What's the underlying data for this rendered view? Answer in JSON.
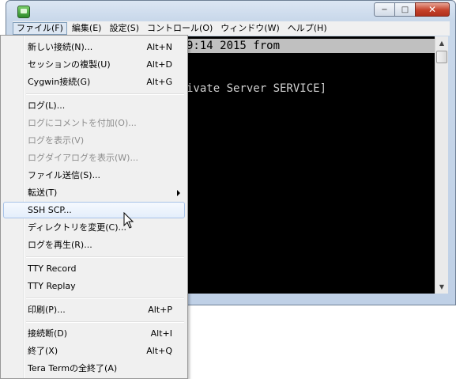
{
  "window": {
    "caption_buttons": {
      "minimize": "−",
      "maximize": "□",
      "close": "✕"
    }
  },
  "menubar": {
    "items": [
      "ファイル(F)",
      "編集(E)",
      "設定(S)",
      "コントロール(O)",
      "ウィンドウ(W)",
      "ヘルプ(H)"
    ],
    "active_index": 0
  },
  "terminal": {
    "lines": [
      "9:14 2015 from",
      "ivate Server SERVICE]"
    ],
    "bg_color": "#000000",
    "fg_color": "#d0d0d0"
  },
  "file_menu": {
    "items": [
      {
        "label": "新しい接続(N)...",
        "shortcut": "Alt+N",
        "enabled": true
      },
      {
        "label": "セッションの複製(U)",
        "shortcut": "Alt+D",
        "enabled": true
      },
      {
        "label": "Cygwin接続(G)",
        "shortcut": "Alt+G",
        "enabled": true
      },
      {
        "label": "ログ(L)...",
        "shortcut": "",
        "enabled": true
      },
      {
        "label": "ログにコメントを付加(O)...",
        "shortcut": "",
        "enabled": false
      },
      {
        "label": "ログを表示(V)",
        "shortcut": "",
        "enabled": false
      },
      {
        "label": "ログダイアログを表示(W)...",
        "shortcut": "",
        "enabled": false
      },
      {
        "label": "ファイル送信(S)...",
        "shortcut": "",
        "enabled": true
      },
      {
        "label": "転送(T)",
        "shortcut": "",
        "enabled": true,
        "submenu": true
      },
      {
        "label": "SSH SCP...",
        "shortcut": "",
        "enabled": true,
        "highlighted": true
      },
      {
        "label": "ディレクトリを変更(C)...",
        "shortcut": "",
        "enabled": true
      },
      {
        "label": "ログを再生(R)...",
        "shortcut": "",
        "enabled": true
      },
      {
        "label": "TTY Record",
        "shortcut": "",
        "enabled": true
      },
      {
        "label": "TTY Replay",
        "shortcut": "",
        "enabled": true
      },
      {
        "label": "印刷(P)...",
        "shortcut": "Alt+P",
        "enabled": true
      },
      {
        "label": "接続断(D)",
        "shortcut": "Alt+I",
        "enabled": true
      },
      {
        "label": "終了(X)",
        "shortcut": "Alt+Q",
        "enabled": true
      },
      {
        "label": "Tera Termの全終了(A)",
        "shortcut": "",
        "enabled": true
      }
    ],
    "highlight_color": "#e4eefb",
    "disabled_color": "#8d8d8d"
  }
}
